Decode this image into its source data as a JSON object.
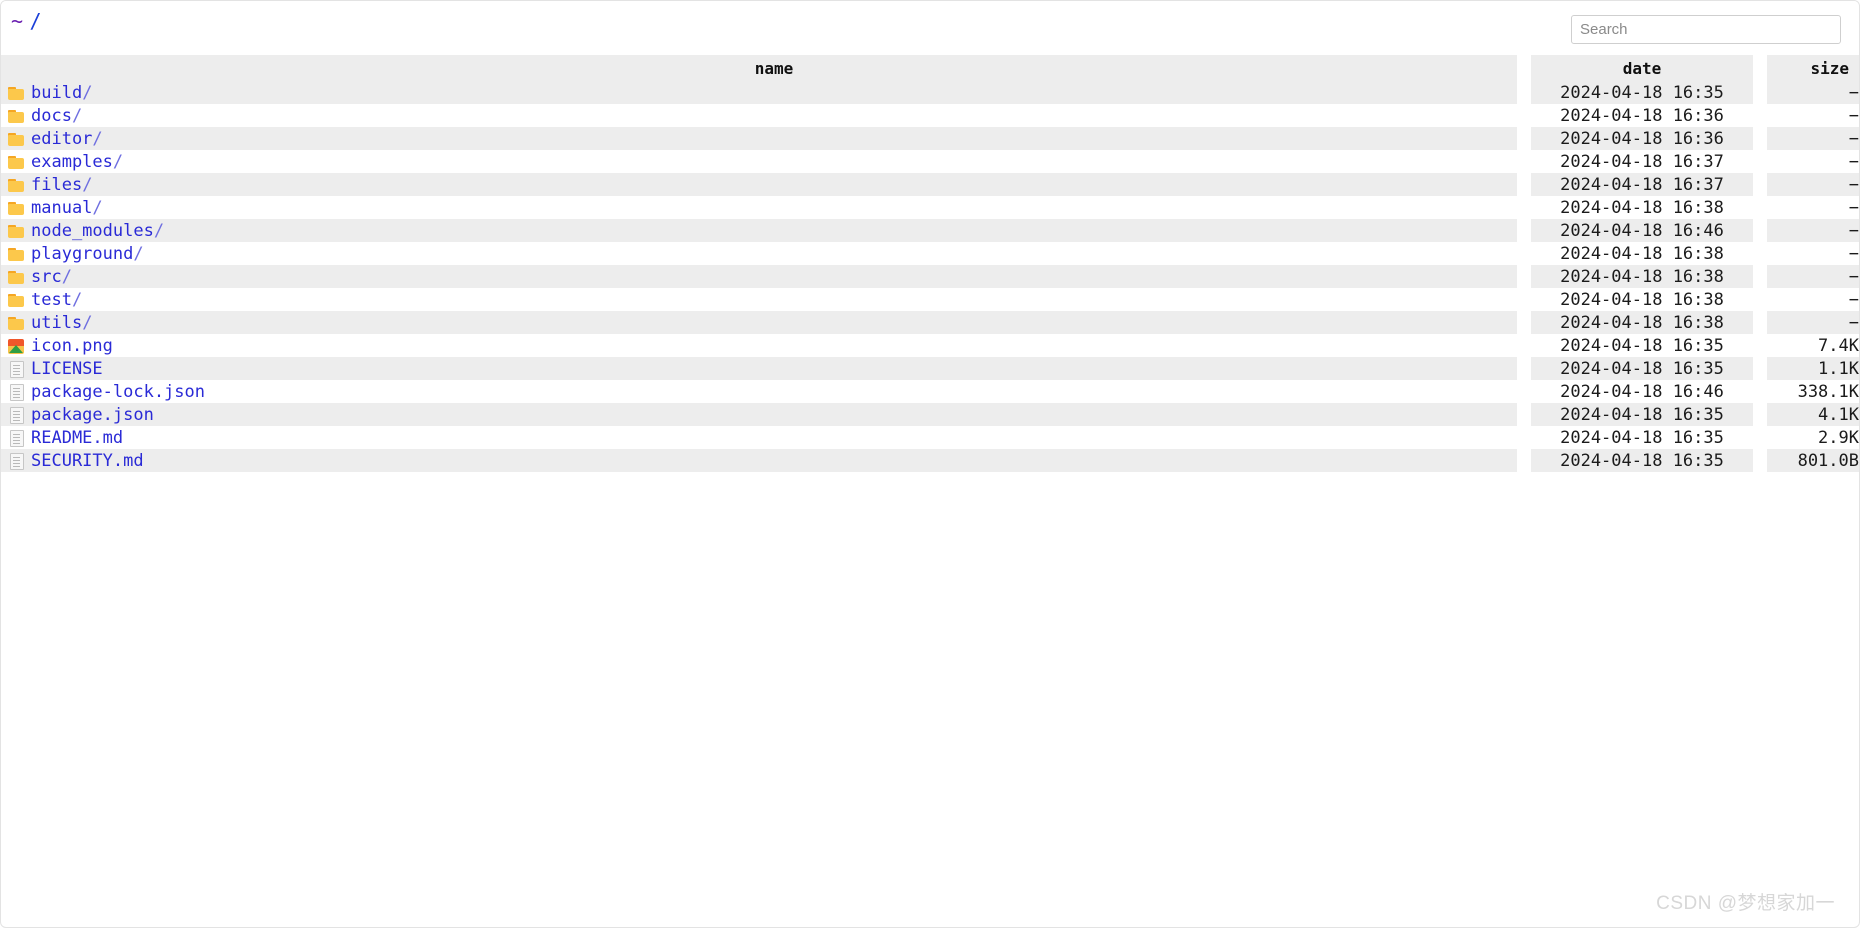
{
  "window": {
    "background": "#ffffff",
    "watermark": "CSDN @梦想家加一"
  },
  "breadcrumb": {
    "home": "~",
    "separator": "/",
    "path": "~ /"
  },
  "search": {
    "placeholder": "Search",
    "value": ""
  },
  "table": {
    "headers": {
      "name": "name",
      "date": "date",
      "size": "size"
    },
    "colors": {
      "link": "#2a2ad6",
      "stripe": "#ededed",
      "header_bg": "#ededed",
      "folder": "#fcc84b"
    },
    "rows": [
      {
        "icon": "folder-icon",
        "name": "build",
        "suffix": "/",
        "date": "2024-04-18 16:35",
        "size": "−"
      },
      {
        "icon": "folder-icon",
        "name": "docs",
        "suffix": "/",
        "date": "2024-04-18 16:36",
        "size": "−"
      },
      {
        "icon": "folder-icon",
        "name": "editor",
        "suffix": "/",
        "date": "2024-04-18 16:36",
        "size": "−"
      },
      {
        "icon": "folder-icon",
        "name": "examples",
        "suffix": "/",
        "date": "2024-04-18 16:37",
        "size": "−"
      },
      {
        "icon": "folder-icon",
        "name": "files",
        "suffix": "/",
        "date": "2024-04-18 16:37",
        "size": "−"
      },
      {
        "icon": "folder-icon",
        "name": "manual",
        "suffix": "/",
        "date": "2024-04-18 16:38",
        "size": "−"
      },
      {
        "icon": "folder-icon",
        "name": "node_modules",
        "suffix": "/",
        "date": "2024-04-18 16:46",
        "size": "−"
      },
      {
        "icon": "folder-icon",
        "name": "playground",
        "suffix": "/",
        "date": "2024-04-18 16:38",
        "size": "−"
      },
      {
        "icon": "folder-icon",
        "name": "src",
        "suffix": "/",
        "date": "2024-04-18 16:38",
        "size": "−"
      },
      {
        "icon": "folder-icon",
        "name": "test",
        "suffix": "/",
        "date": "2024-04-18 16:38",
        "size": "−"
      },
      {
        "icon": "folder-icon",
        "name": "utils",
        "suffix": "/",
        "date": "2024-04-18 16:38",
        "size": "−"
      },
      {
        "icon": "image-icon",
        "name": "icon.png",
        "suffix": "",
        "date": "2024-04-18 16:35",
        "size": "7.4K"
      },
      {
        "icon": "document-icon",
        "name": "LICENSE",
        "suffix": "",
        "date": "2024-04-18 16:35",
        "size": "1.1K"
      },
      {
        "icon": "document-icon",
        "name": "package-lock.json",
        "suffix": "",
        "date": "2024-04-18 16:46",
        "size": "338.1K"
      },
      {
        "icon": "document-icon",
        "name": "package.json",
        "suffix": "",
        "date": "2024-04-18 16:35",
        "size": "4.1K"
      },
      {
        "icon": "document-icon",
        "name": "README.md",
        "suffix": "",
        "date": "2024-04-18 16:35",
        "size": "2.9K"
      },
      {
        "icon": "document-icon",
        "name": "SECURITY.md",
        "suffix": "",
        "date": "2024-04-18 16:35",
        "size": "801.0B"
      }
    ]
  }
}
